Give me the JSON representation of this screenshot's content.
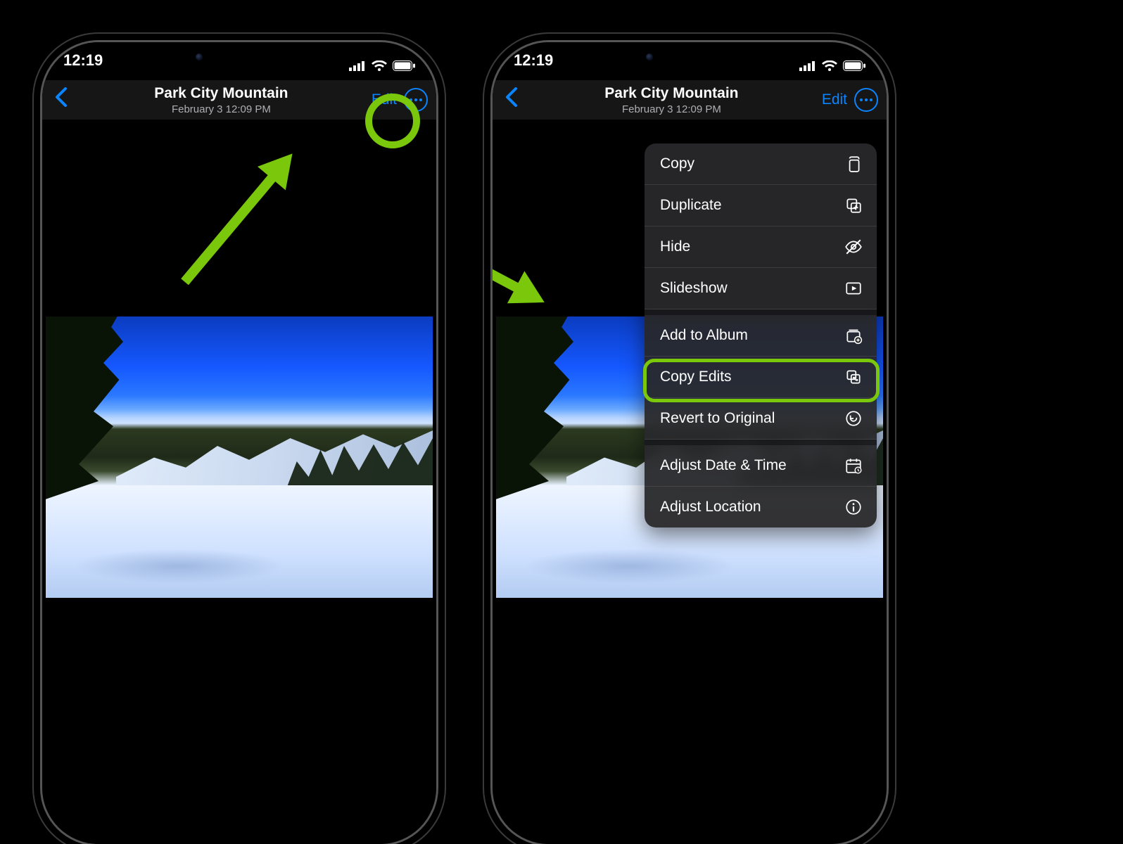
{
  "status": {
    "time": "12:19"
  },
  "nav": {
    "title": "Park City Mountain",
    "subtitle": "February 3  12:09 PM",
    "edit": "Edit"
  },
  "menu": {
    "items": [
      {
        "label": "Copy",
        "icon": "copy"
      },
      {
        "label": "Duplicate",
        "icon": "duplicate"
      },
      {
        "label": "Hide",
        "icon": "hide"
      },
      {
        "label": "Slideshow",
        "icon": "slideshow"
      },
      {
        "label": "Add to Album",
        "icon": "album"
      },
      {
        "label": "Copy Edits",
        "icon": "copy-edits"
      },
      {
        "label": "Revert to Original",
        "icon": "revert"
      },
      {
        "label": "Adjust Date & Time",
        "icon": "datetime"
      },
      {
        "label": "Adjust Location",
        "icon": "location"
      }
    ]
  },
  "annotation": {
    "left_target": "more-button",
    "right_target": "menu-item-copy-edits"
  }
}
